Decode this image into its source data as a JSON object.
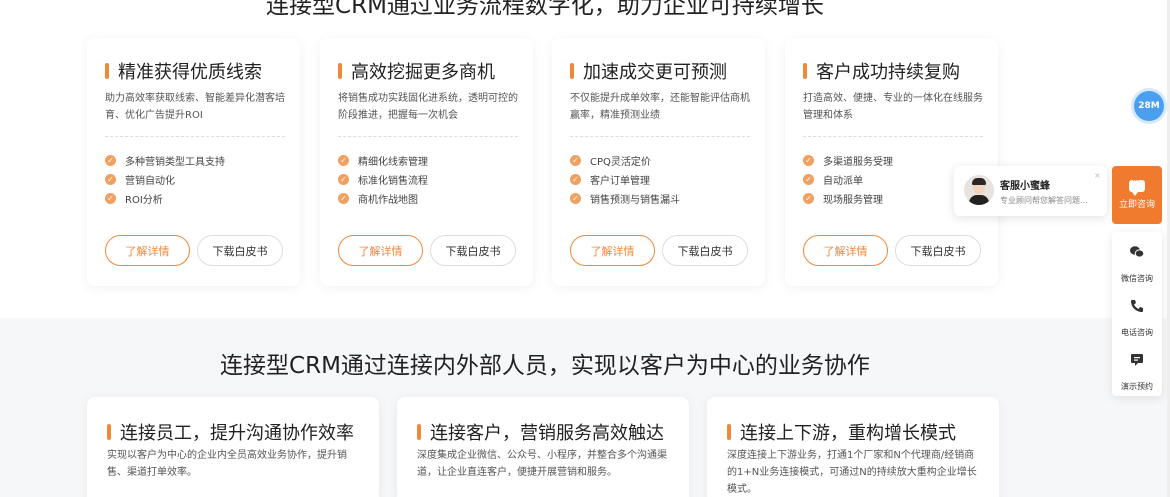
{
  "top_heading": "连接型CRM通过业务流程数字化，助力企业可持续增长",
  "bottom_heading": "连接型CRM通过连接内外部人员，实现以客户为中心的业务协作",
  "cards": [
    {
      "title": "精准获得优质线索",
      "desc": "助力高效率获取线索、智能差异化潜客培育、优化广告提升ROI",
      "features": [
        "多种营销类型工具支持",
        "营销自动化",
        "ROI分析"
      ],
      "detail": "了解详情",
      "download": "下载白皮书"
    },
    {
      "title": "高效挖掘更多商机",
      "desc": "将销售成功实践固化进系统，透明可控的阶段推进，把握每一次机会",
      "features": [
        "精细化线索管理",
        "标准化销售流程",
        "商机作战地图"
      ],
      "detail": "了解详情",
      "download": "下载白皮书"
    },
    {
      "title": "加速成交更可预测",
      "desc": "不仅能提升成单效率，还能智能评估商机赢率，精准预测业绩",
      "features": [
        "CPQ灵活定价",
        "客户订单管理",
        "销售预测与销售漏斗"
      ],
      "detail": "了解详情",
      "download": "下载白皮书"
    },
    {
      "title": "客户成功持续复购",
      "desc": "打造高效、便捷、专业的一体化在线服务管理和体系",
      "features": [
        "多渠道服务受理",
        "自动派单",
        "现场服务管理"
      ],
      "detail": "了解详情",
      "download": "下载白皮书"
    }
  ],
  "cards2": [
    {
      "title": "连接员工，提升沟通协作效率",
      "desc": "实现以客户为中心的企业内全员高效业务协作，提升销售、渠道打单效率。"
    },
    {
      "title": "连接客户，营销服务高效触达",
      "desc": "深度集成企业微信、公众号、小程序，并整合多个沟通渠道，让企业直连客户，便捷开展营销和服务。"
    },
    {
      "title": "连接上下游，重构增长模式",
      "desc": "深度连接上下游业务，打通1个厂家和N个代理商/经销商的1+N业务连接模式，可通过N的持续放大重构企业增长模式。"
    }
  ],
  "avatar_badge": "28M",
  "customer_service": {
    "name": "客服小蜜蜂",
    "subtitle": "专业顾问帮您解答问题...",
    "close": "×"
  },
  "side_bar": {
    "consult": "立即咨询",
    "wechat": "微信咨询",
    "phone": "电话咨询",
    "demo": "演示预约"
  },
  "icons": {
    "check": "check-icon",
    "chat": "chat-icon",
    "wechat": "wechat-icon",
    "phone": "phone-icon",
    "demo": "demo-icon"
  },
  "colors": {
    "accent": "#f0883a",
    "consult_bg": "#f07a2e",
    "badge_bg": "#4a9ff0"
  }
}
